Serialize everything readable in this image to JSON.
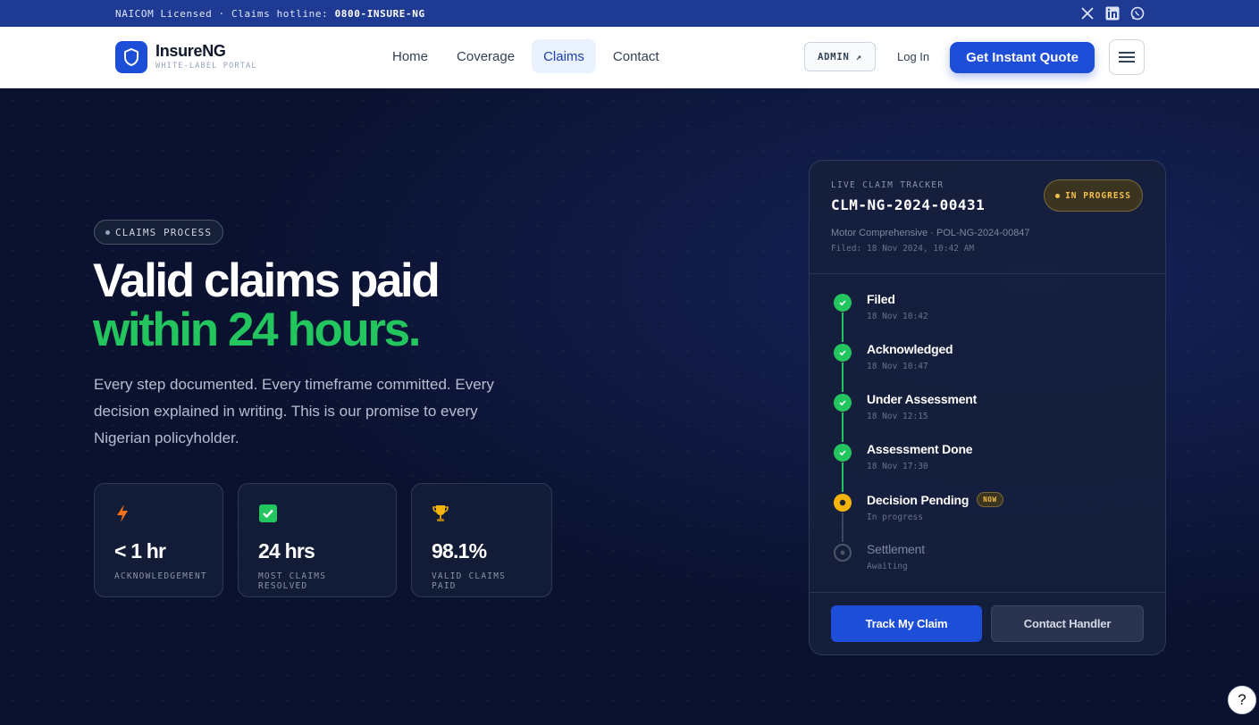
{
  "topbar": {
    "notice": "NAICOM Licensed · Claims hotline: ",
    "hotline": "0800-INSURE-NG",
    "socials": [
      "x-icon",
      "linkedin-icon",
      "whatsapp-icon"
    ]
  },
  "nav": {
    "brand_name": "InsureNG",
    "brand_sub": "WHITE-LABEL PORTAL",
    "items": [
      {
        "label": "Home",
        "active": false
      },
      {
        "label": "Coverage",
        "active": false
      },
      {
        "label": "Claims",
        "active": true
      },
      {
        "label": "Contact",
        "active": false
      }
    ],
    "admin_label": "ADMIN ↗",
    "login_label": "Log In",
    "quote_label": "Get Instant Quote"
  },
  "hero": {
    "pill": "CLAIMS PROCESS",
    "title_line1": "Valid claims paid",
    "title_line2": "within 24 hours.",
    "lead": "Every step documented. Every timeframe committed. Every decision explained in writing. This is our promise to every Nigerian policyholder.",
    "stats": [
      {
        "icon": "lightning-icon",
        "value": "< 1 hr",
        "label": "ACKNOWLEDGEMENT"
      },
      {
        "icon": "check-box-icon",
        "value": "24 hrs",
        "label": "MOST CLAIMS RESOLVED"
      },
      {
        "icon": "trophy-icon",
        "value": "98.1%",
        "label": "VALID CLAIMS PAID"
      }
    ]
  },
  "tracker": {
    "kicker": "LIVE CLAIM TRACKER",
    "claim_id": "CLM-NG-2024-00431",
    "status_badge": "IN PROGRESS",
    "policy": "Motor Comprehensive · POL-NG-2024-00847",
    "filed": "Filed: 18 Nov 2024, 10:42 AM",
    "steps": [
      {
        "title": "Filed",
        "detail": "18 Nov 10:42",
        "state": "done"
      },
      {
        "title": "Acknowledged",
        "detail": "18 Nov 10:47",
        "state": "done"
      },
      {
        "title": "Under Assessment",
        "detail": "18 Nov 12:15",
        "state": "done"
      },
      {
        "title": "Assessment Done",
        "detail": "18 Nov 17:30",
        "state": "done"
      },
      {
        "title": "Decision Pending",
        "detail": "In progress",
        "state": "current",
        "tag": "NOW"
      },
      {
        "title": "Settlement",
        "detail": "Awaiting",
        "state": "pending"
      }
    ],
    "track_label": "Track My Claim",
    "contact_label": "Contact Handler"
  },
  "help_label": "?",
  "colors": {
    "brand": "#1d4ed8",
    "accent_green": "#22c55e",
    "warning": "#f5b40a",
    "hero_bg": "#0b1230"
  }
}
